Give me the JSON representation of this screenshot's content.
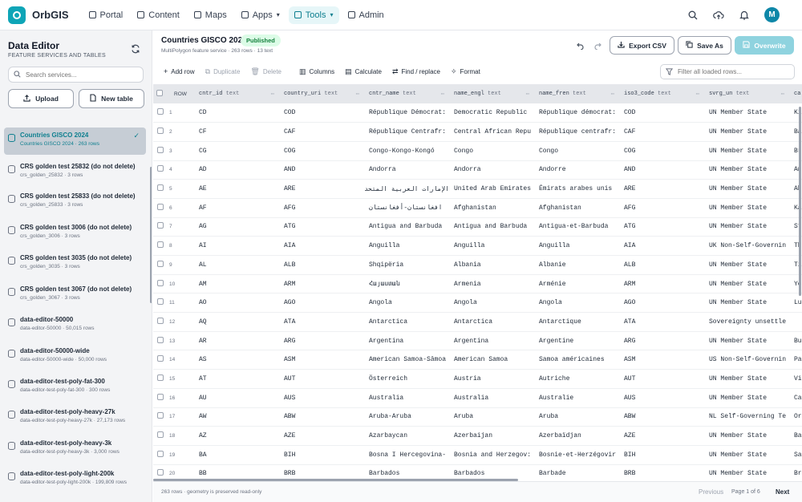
{
  "app": {
    "name": "OrbGIS"
  },
  "nav": [
    {
      "label": "Portal",
      "icon": "grid-icon"
    },
    {
      "label": "Content",
      "icon": "document-icon"
    },
    {
      "label": "Maps",
      "icon": "map-icon"
    },
    {
      "label": "Apps",
      "icon": "apps-icon",
      "chevron": true
    },
    {
      "label": "Tools",
      "icon": "wrench-icon",
      "chevron": true,
      "active": true
    },
    {
      "label": "Admin",
      "icon": "gear-icon"
    }
  ],
  "user": {
    "initial": "M"
  },
  "sidebar": {
    "title": "Data Editor",
    "subtitle": "FEATURE SERVICES AND TABLES",
    "search_placeholder": "Search services...",
    "upload_label": "Upload",
    "newtable_label": "New table",
    "items": [
      {
        "name": "Countries GISCO 2024",
        "meta": "Countries GISCO 2024 · 263 rows",
        "selected": true
      },
      {
        "name": "CRS golden test 25832 (do not delete)",
        "meta": "crs_golden_25832 · 3 rows"
      },
      {
        "name": "CRS golden test 25833 (do not delete)",
        "meta": "crs_golden_25833 · 3 rows"
      },
      {
        "name": "CRS golden test 3006 (do not delete)",
        "meta": "crs_golden_3006 · 3 rows"
      },
      {
        "name": "CRS golden test 3035 (do not delete)",
        "meta": "crs_golden_3035 · 3 rows"
      },
      {
        "name": "CRS golden test 3067 (do not delete)",
        "meta": "crs_golden_3067 · 3 rows"
      },
      {
        "name": "data-editor-50000",
        "meta": "data-editor-50000 · 50,015 rows"
      },
      {
        "name": "data-editor-50000-wide",
        "meta": "data-editor-50000-wide · 50,000 rows"
      },
      {
        "name": "data-editor-test-poly-fat-300",
        "meta": "data-editor-test-poly-fat-300 · 300 rows"
      },
      {
        "name": "data-editor-test-poly-heavy-27k",
        "meta": "data-editor-test-poly-heavy-27k · 27,173 rows"
      },
      {
        "name": "data-editor-test-poly-heavy-3k",
        "meta": "data-editor-test-poly-heavy-3k · 3,000 rows"
      },
      {
        "name": "data-editor-test-poly-light-200k",
        "meta": "data-editor-test-poly-light-200k · 199,809 rows"
      }
    ]
  },
  "dataset": {
    "title": "Countries GISCO 2024",
    "status": "Published",
    "subtitle": "MultiPolygon feature service · 263 rows · 13 text"
  },
  "actions": {
    "export": "Export CSV",
    "saveas": "Save As",
    "overwrite": "Overwrite"
  },
  "toolbar": {
    "add_row": "Add row",
    "duplicate": "Duplicate",
    "delete": "Delete",
    "columns": "Columns",
    "calculate": "Calculate",
    "find_replace": "Find / replace",
    "format": "Format",
    "filter_placeholder": "Filter all loaded rows..."
  },
  "table": {
    "row_header": "ROW",
    "columns": [
      {
        "name": "cntr_id",
        "type": "text"
      },
      {
        "name": "country_uri",
        "type": "text"
      },
      {
        "name": "cntr_name",
        "type": "text"
      },
      {
        "name": "name_engl",
        "type": "text"
      },
      {
        "name": "name_fren",
        "type": "text"
      },
      {
        "name": "iso3_code",
        "type": "text"
      },
      {
        "name": "svrg_un",
        "type": "text"
      },
      {
        "name": "ca",
        "type": ""
      }
    ],
    "rows": [
      [
        "1",
        "CD",
        "COD",
        "République Démocrat:",
        "Democratic Republic",
        "République démocrat:",
        "COD",
        "UN Member State",
        "Ki"
      ],
      [
        "2",
        "CF",
        "CAF",
        "République Centrafr:",
        "Central African Repu",
        "République centrafr:",
        "CAF",
        "UN Member State",
        "Ba"
      ],
      [
        "3",
        "CG",
        "COG",
        "Congo-Kongo-Kongó",
        "Congo",
        "Congo",
        "COG",
        "UN Member State",
        "Br"
      ],
      [
        "4",
        "AD",
        "AND",
        "Andorra",
        "Andorra",
        "Andorre",
        "AND",
        "UN Member State",
        "An"
      ],
      [
        "5",
        "AE",
        "ARE",
        "الإمارات العربية المتحدة",
        "United Arab Emirates",
        "Émirats arabes unis",
        "ARE",
        "UN Member State",
        "Ab"
      ],
      [
        "6",
        "AF",
        "AFG",
        "افغانستان-أفغانستان",
        "Afghanistan",
        "Afghanistan",
        "AFG",
        "UN Member State",
        "Ka"
      ],
      [
        "7",
        "AG",
        "ATG",
        "Antigua and Barbuda",
        "Antigua and Barbuda",
        "Antigua-et-Barbuda",
        "ATG",
        "UN Member State",
        "St"
      ],
      [
        "8",
        "AI",
        "AIA",
        "Anguilla",
        "Anguilla",
        "Anguilla",
        "AIA",
        "UK Non-Self-Governin",
        "Th"
      ],
      [
        "9",
        "AL",
        "ALB",
        "Shqipëria",
        "Albania",
        "Albanie",
        "ALB",
        "UN Member State",
        "Ti"
      ],
      [
        "10",
        "AM",
        "ARM",
        "Հայաստան",
        "Armenia",
        "Arménie",
        "ARM",
        "UN Member State",
        "Ye"
      ],
      [
        "11",
        "AO",
        "AGO",
        "Angola",
        "Angola",
        "Angola",
        "AGO",
        "UN Member State",
        "Lu"
      ],
      [
        "12",
        "AQ",
        "ATA",
        "Antarctica",
        "Antarctica",
        "Antarctique",
        "ATA",
        "Sovereignty unsettle",
        ""
      ],
      [
        "13",
        "AR",
        "ARG",
        "Argentina",
        "Argentina",
        "Argentine",
        "ARG",
        "UN Member State",
        "Bu"
      ],
      [
        "14",
        "AS",
        "ASM",
        "American Samoa-Sāmoa",
        "American Samoa",
        "Samoa américaines",
        "ASM",
        "US Non-Self-Governin",
        "Pa"
      ],
      [
        "15",
        "AT",
        "AUT",
        "Österreich",
        "Austria",
        "Autriche",
        "AUT",
        "UN Member State",
        "Vi"
      ],
      [
        "16",
        "AU",
        "AUS",
        "Australia",
        "Australia",
        "Australie",
        "AUS",
        "UN Member State",
        "Ca"
      ],
      [
        "17",
        "AW",
        "ABW",
        "Aruba-Aruba",
        "Aruba",
        "Aruba",
        "ABW",
        "NL Self-Governing Te",
        "Or"
      ],
      [
        "18",
        "AZ",
        "AZE",
        "Azarbaycan",
        "Azerbaijan",
        "Azerbaïdjan",
        "AZE",
        "UN Member State",
        "Ba"
      ],
      [
        "19",
        "BA",
        "BIH",
        "Bosna I Hercegovina-",
        "Bosnia and Herzegov:",
        "Bosnie-et-Herzégovir",
        "BIH",
        "UN Member State",
        "Sa"
      ],
      [
        "20",
        "BB",
        "BRB",
        "Barbados",
        "Barbados",
        "Barbade",
        "BRB",
        "UN Member State",
        "Br"
      ]
    ]
  },
  "footer": {
    "info": "263 rows · geometry is preserved read-only",
    "previous": "Previous",
    "page": "Page 1 of 6",
    "next": "Next"
  }
}
